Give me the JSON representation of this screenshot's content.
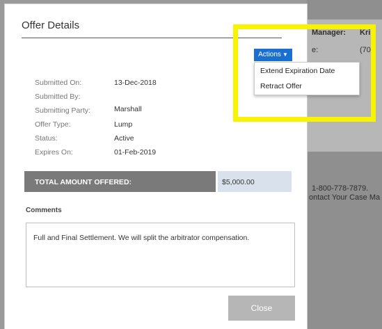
{
  "background": {
    "manager_label": "Manager:",
    "manager_value": "Kri",
    "row2_label": "e:",
    "row2_value": "(70",
    "phone_line": "1-800-778-7879.",
    "contact_line": "ontact Your Case Ma"
  },
  "modal": {
    "title": "Offer Details",
    "actions_label": "Actions",
    "actions_menu": [
      "Extend Expiration Date",
      "Retract Offer"
    ],
    "details": [
      {
        "label": "Submitted On:",
        "value": "13-Dec-2018"
      },
      {
        "label": "Submitted By:",
        "value": ""
      },
      {
        "label": "Submitting Party:",
        "value": "Marshall"
      },
      {
        "label": "Offer Type:",
        "value": "Lump"
      },
      {
        "label": "Status:",
        "value": "Active"
      },
      {
        "label": "Expires On:",
        "value": "01-Feb-2019"
      }
    ],
    "total_label": "TOTAL AMOUNT OFFERED:",
    "total_value": "$5,000.00",
    "comments_label": "Comments",
    "comments_text": "Full and Final Settlement. We will split the arbitrator compensation.",
    "close_label": "Close"
  },
  "colors": {
    "highlight": "#f8f400",
    "actions_button": "#1b6fd1",
    "total_bar": "#7a7a7a"
  }
}
